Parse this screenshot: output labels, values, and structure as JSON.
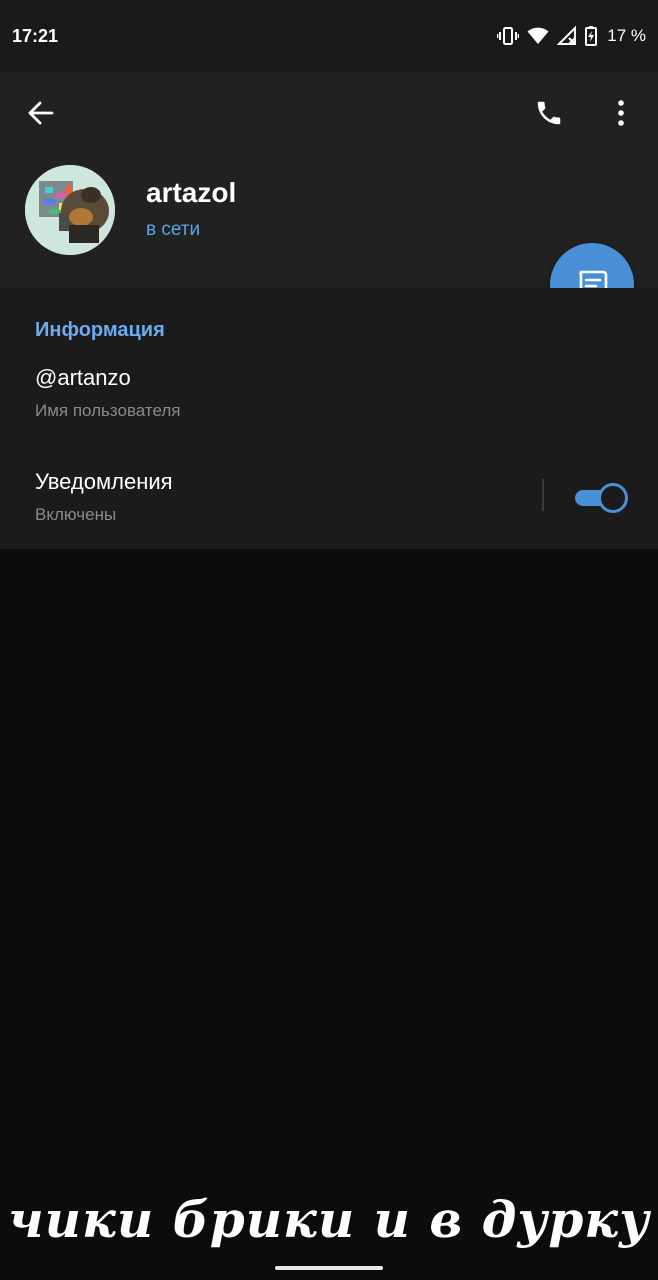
{
  "status_bar": {
    "time": "17:21",
    "battery": "17 %",
    "icons": [
      "vibrate-icon",
      "wifi-icon",
      "signal-no-data-icon",
      "battery-charging-icon"
    ]
  },
  "header": {
    "back_icon": "arrow-back-icon",
    "call_icon": "phone-icon",
    "menu_icon": "more-vert-icon",
    "name": "artazol",
    "status": "в сети",
    "fab_icon": "message-icon",
    "colors": {
      "accent": "#4a90d9",
      "online": "#5aa3e8"
    }
  },
  "info": {
    "title": "Информация",
    "username": "@artanzo",
    "username_caption": "Имя пользователя",
    "notifications_label": "Уведомления",
    "notifications_caption": "Включены",
    "notifications_enabled": true
  },
  "overlay": {
    "caption": "чики брики и в дурку"
  }
}
